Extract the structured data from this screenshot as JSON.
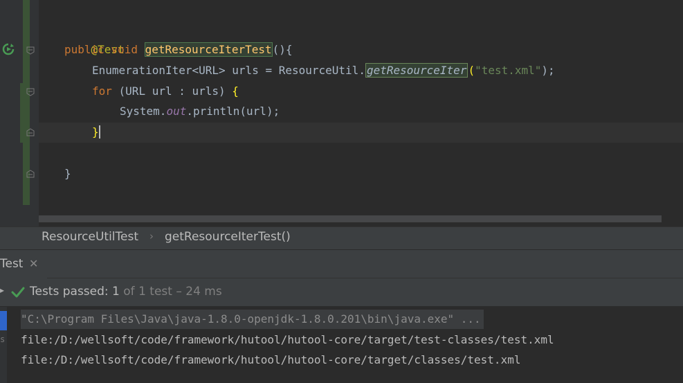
{
  "editor": {
    "annotation": "@Test",
    "method_sig": {
      "kw1": "public",
      "kw2": "void",
      "name": "getResourceIterTest",
      "rest": "(){"
    },
    "line_enum": {
      "type": "EnumerationIter<URL> urls = ResourceUtil.",
      "method": "getResourceIter",
      "open": "(",
      "arg": "\"test.xml\"",
      "close": ");"
    },
    "line_for": {
      "kw": "for",
      "rest": " (URL url : urls) ",
      "brace": "{"
    },
    "line_print": {
      "pre": "System.",
      "field": "out",
      "post": ".println(url);"
    },
    "close_for": "}",
    "close_method": "}"
  },
  "breadcrumb": {
    "items": [
      "ResourceUtilTest",
      "getResourceIterTest()"
    ],
    "separator": "›"
  },
  "tool_window": {
    "tab_label": "Test",
    "close_glyph": "✕"
  },
  "status": {
    "prefix": "Tests passed:",
    "passed": "1",
    "of_text": "of 1 test",
    "duration": "– 24 ms"
  },
  "console": {
    "lines": [
      "\"C:\\Program Files\\Java\\java-1.8.0-openjdk-1.8.0.201\\bin\\java.exe\" ...",
      "file:/D:/wellsoft/code/framework/hutool/hutool-core/target/test-classes/test.xml",
      "file:/D:/wellsoft/code/framework/hutool/hutool-core/target/classes/test.xml"
    ]
  },
  "colors": {
    "editor_bg": "#2b2b2b",
    "keyword": "#cc7832",
    "annotation": "#bbb529",
    "method": "#ffc66d",
    "string": "#6a8759",
    "field": "#9876aa",
    "pass_green": "#499c54"
  }
}
